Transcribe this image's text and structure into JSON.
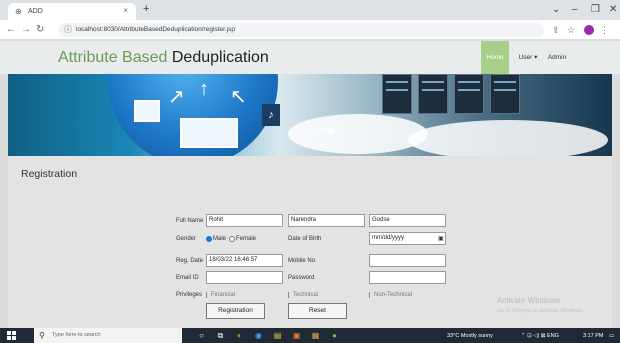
{
  "browser": {
    "tab_title": "ADD",
    "tab_close": "×",
    "new_tab": "+",
    "url": "localhost:8030/AttributeBasedDeduplication/register.jsp",
    "window_controls": [
      "⌄",
      "–",
      "❐",
      "✕"
    ],
    "icons": [
      "back-icon",
      "forward-icon",
      "reload-icon",
      "info-icon",
      "share-icon",
      "star-icon",
      "sidebar-icon",
      "profile-icon",
      "menu-icon"
    ]
  },
  "site": {
    "title_part1": "Attribute Based",
    "title_part2": "Deduplication",
    "menu": [
      "Home",
      "User ▾",
      "Admin"
    ],
    "colors": {
      "title_green": "#6c9a53",
      "home_bg": "#a8cf87"
    }
  },
  "banner": {
    "slides": 4,
    "active_slide": 4
  },
  "registration": {
    "heading": "Registration",
    "labels": {
      "full_name": "Full Name",
      "gender": "Gender",
      "male": "Male",
      "female": "Female",
      "date_of_birth": "Date of Birth",
      "reg_date": "Reg. Date",
      "mobile": "Mobile No.",
      "email": "Email ID",
      "password": "Password",
      "privileges": "Privileges",
      "financial": "Financial",
      "technical": "Technical",
      "non_technical": "Non-Technical"
    },
    "values": {
      "first_name": "Rohit",
      "middle_name": "Narendra",
      "last_name": "Godse",
      "dob_placeholder": "mm/dd/yyyy",
      "reg_date": "18/03/22 16:46:57",
      "mobile": "",
      "email": "",
      "password": "",
      "gender_selected": "Male"
    },
    "buttons": {
      "submit": "Registration",
      "reset": "Reset"
    }
  },
  "watermark": {
    "line1": "Activate Windows",
    "line2": "Go to Settings to activate Windows."
  },
  "taskbar": {
    "search_placeholder": "Type here to search",
    "weather": "33°C  Mostly sunny",
    "tray_icons": "⌃  ⊡  ◁)  ⊠  ENG",
    "time": "3:17 PM"
  }
}
